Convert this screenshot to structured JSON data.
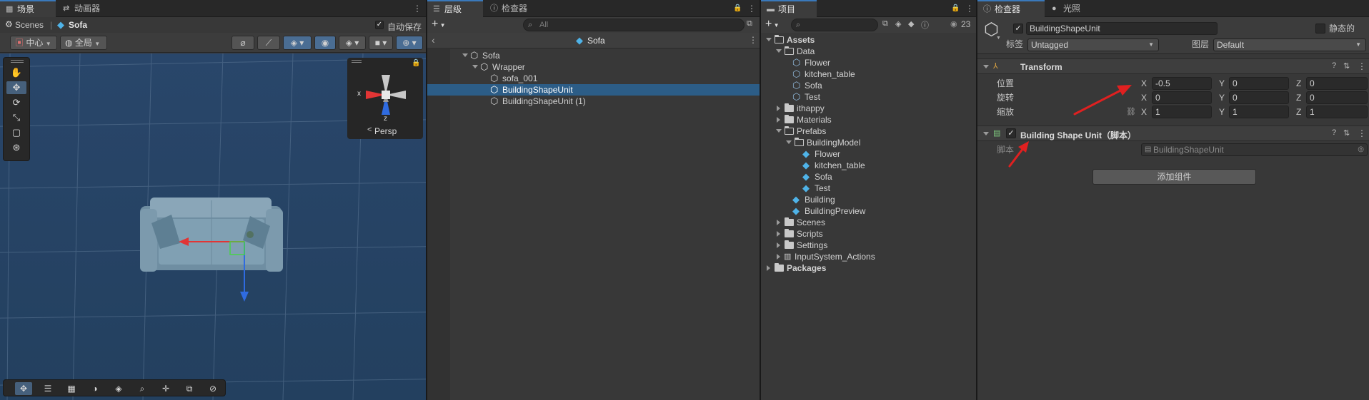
{
  "scene_panel": {
    "tabs": [
      {
        "label": "场景",
        "icon": "grid-icon"
      },
      {
        "label": "动画器",
        "icon": "animator-icon"
      }
    ],
    "breadcrumb": {
      "root": "Scenes",
      "separator": "|",
      "current": "Sofa"
    },
    "auto_save_label": "自动保存",
    "auto_save_checked": true,
    "pivot_dropdown": "中心",
    "space_dropdown": "全局",
    "persp_label": "Persp",
    "gizmo_x_label": "x",
    "gizmo_z_label": "z"
  },
  "hierarchy_panel": {
    "tabs": [
      {
        "label": "层级",
        "icon": "hierarchy-icon"
      },
      {
        "label": "检查器",
        "icon": "info-icon"
      }
    ],
    "search_placeholder": "All",
    "header_title": "Sofa",
    "items": [
      {
        "label": "Sofa",
        "depth": 0,
        "expanded": true,
        "selected": false
      },
      {
        "label": "Wrapper",
        "depth": 1,
        "expanded": true,
        "selected": false
      },
      {
        "label": "sofa_001",
        "depth": 2,
        "expanded": null,
        "selected": false
      },
      {
        "label": "BuildingShapeUnit",
        "depth": 2,
        "expanded": null,
        "selected": true
      },
      {
        "label": "BuildingShapeUnit (1)",
        "depth": 2,
        "expanded": null,
        "selected": false
      }
    ]
  },
  "project_panel": {
    "tab_label": "项目",
    "asset_count": "23",
    "tree": [
      {
        "label": "Assets",
        "depth": 0,
        "type": "folder-open",
        "expanded": true,
        "bold": true
      },
      {
        "label": "Data",
        "depth": 1,
        "type": "folder-open",
        "expanded": true,
        "bold": false
      },
      {
        "label": "Flower",
        "depth": 2,
        "type": "scriptable",
        "expanded": null,
        "bold": false
      },
      {
        "label": "kitchen_table",
        "depth": 2,
        "type": "scriptable",
        "expanded": null,
        "bold": false
      },
      {
        "label": "Sofa",
        "depth": 2,
        "type": "scriptable",
        "expanded": null,
        "bold": false
      },
      {
        "label": "Test",
        "depth": 2,
        "type": "scriptable",
        "expanded": null,
        "bold": false
      },
      {
        "label": "ithappy",
        "depth": 1,
        "type": "folder",
        "expanded": false,
        "bold": false
      },
      {
        "label": "Materials",
        "depth": 1,
        "type": "folder",
        "expanded": false,
        "bold": false
      },
      {
        "label": "Prefabs",
        "depth": 1,
        "type": "folder-open",
        "expanded": true,
        "bold": false
      },
      {
        "label": "BuildingModel",
        "depth": 2,
        "type": "folder-open",
        "expanded": true,
        "bold": false
      },
      {
        "label": "Flower",
        "depth": 3,
        "type": "prefab",
        "expanded": null,
        "bold": false
      },
      {
        "label": "kitchen_table",
        "depth": 3,
        "type": "prefab",
        "expanded": null,
        "bold": false
      },
      {
        "label": "Sofa",
        "depth": 3,
        "type": "prefab",
        "expanded": null,
        "bold": false
      },
      {
        "label": "Test",
        "depth": 3,
        "type": "prefab",
        "expanded": null,
        "bold": false
      },
      {
        "label": "Building",
        "depth": 2,
        "type": "prefab",
        "expanded": null,
        "bold": false
      },
      {
        "label": "BuildingPreview",
        "depth": 2,
        "type": "prefab",
        "expanded": null,
        "bold": false
      },
      {
        "label": "Scenes",
        "depth": 1,
        "type": "folder",
        "expanded": false,
        "bold": false
      },
      {
        "label": "Scripts",
        "depth": 1,
        "type": "folder",
        "expanded": false,
        "bold": false
      },
      {
        "label": "Settings",
        "depth": 1,
        "type": "folder",
        "expanded": false,
        "bold": false
      },
      {
        "label": "InputSystem_Actions",
        "depth": 1,
        "type": "input-actions",
        "expanded": false,
        "bold": false
      },
      {
        "label": "Packages",
        "depth": 0,
        "type": "folder",
        "expanded": false,
        "bold": true
      }
    ]
  },
  "inspector_panel": {
    "tabs": [
      {
        "label": "检查器",
        "icon": "info-icon"
      },
      {
        "label": "光照",
        "icon": "light-icon"
      }
    ],
    "object_name": "BuildingShapeUnit",
    "active_checked": true,
    "static_label": "静态的",
    "tag_label": "标签",
    "tag_value": "Untagged",
    "layer_label": "图层",
    "layer_value": "Default",
    "transform": {
      "title": "Transform",
      "rows": [
        {
          "label": "位置",
          "x": "-0.5",
          "y": "0",
          "z": "0"
        },
        {
          "label": "旋转",
          "x": "0",
          "y": "0",
          "z": "0"
        },
        {
          "label": "缩放",
          "x": "1",
          "y": "1",
          "z": "1"
        }
      ],
      "axis_labels": [
        "X",
        "Y",
        "Z"
      ]
    },
    "script_component": {
      "title": "Building Shape Unit（脚本）",
      "enabled": true,
      "script_label": "脚本",
      "script_value": "BuildingShapeUnit"
    },
    "add_component_label": "添加组件"
  },
  "colors": {
    "accent": "#2c5d87",
    "tab_highlight": "#3a79bb",
    "scene_bg": "#2c4a6e",
    "annotation_arrow": "#e02020"
  }
}
